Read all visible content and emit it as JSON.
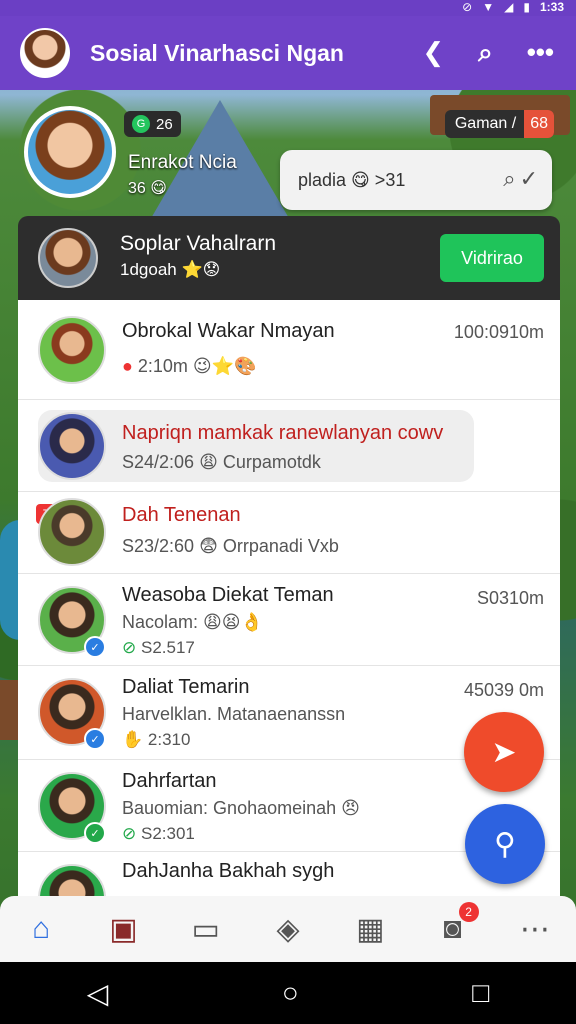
{
  "status_bar": {
    "time": "1:33"
  },
  "app_bar": {
    "title": "Sosial Vinarhasci Ngan",
    "actions": [
      {
        "name": "share-icon",
        "glyph": "❮"
      },
      {
        "name": "search-icon",
        "glyph": "⌕"
      },
      {
        "name": "more-icon",
        "glyph": "•••"
      }
    ]
  },
  "profile": {
    "level": "26",
    "level_icon": "G",
    "name": "Enrakot Ncia",
    "sub": "36 😋",
    "game_label": "Gaman /",
    "game_count": "68"
  },
  "search": {
    "text": "pladia 😋 >31"
  },
  "featured": {
    "name": "Soplar Vahalrarn",
    "sub": "1dgoah ⭐😟",
    "button": "Vidrirao"
  },
  "chats": [
    {
      "title": "Obrokal Wakar Nmayan",
      "sub": "2:10m 😉⭐🎨",
      "time": "100:0910m",
      "title_color": "#2a3fa8"
    },
    {
      "title": "Napriqn mamkak ranewlanyan cowv",
      "sub": "S24/2:06 😩 Curpamotdk",
      "time": "",
      "title_color": "#c0201e"
    },
    {
      "title": "Dah Tenenan",
      "sub": "S23/2:60 😨 Orrpanadi Vxb",
      "time": "",
      "title_color": "#c0201e",
      "badge": "7"
    },
    {
      "title": "Weasoba Diekat Teman",
      "sub": "Nacolam: 😩😫👌",
      "sub2": "S2.517",
      "time": "S0310m",
      "title_color": "#222"
    },
    {
      "title": "Daliat Temarin",
      "sub": "Harvelklan. Matanaenanssn",
      "sub2": "2:310",
      "time": "45039 0m",
      "title_color": "#222"
    },
    {
      "title": "Dahrfartan",
      "sub": "Bauomian: Gnohaomeinah 😠",
      "sub2": "S2:301",
      "time": "",
      "title_color": "#222"
    },
    {
      "title": "DahJanha Bakhah sygh",
      "sub": "",
      "time": "",
      "title_color": "#222"
    }
  ],
  "bottom_nav": [
    {
      "name": "home-icon",
      "glyph": "⌂",
      "active": true
    },
    {
      "name": "store-icon",
      "glyph": "▣"
    },
    {
      "name": "chat-icon",
      "glyph": "▭"
    },
    {
      "name": "tag-icon",
      "glyph": "◈"
    },
    {
      "name": "gallery-icon",
      "glyph": "▦"
    },
    {
      "name": "camera-icon",
      "glyph": "◙",
      "badge": "2"
    },
    {
      "name": "more-icon",
      "glyph": "⋯"
    }
  ],
  "colors": {
    "primary": "#6f42c8",
    "accent_green": "#1fc45a",
    "fab_red": "#ef4b2b",
    "fab_blue": "#2d62e0"
  }
}
